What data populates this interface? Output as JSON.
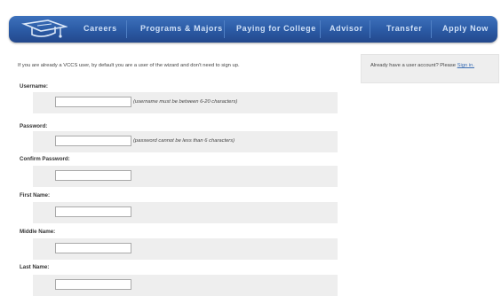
{
  "nav": {
    "items": [
      "Careers",
      "Programs & Majors",
      "Paying for College",
      "Advisor",
      "Transfer",
      "Apply Now"
    ]
  },
  "intro": "If you are already a VCCS user, by default you are a user of the wizard and don't need to sign up.",
  "sidebar": {
    "text": "Already have a user account? Please ",
    "link": "Sign in."
  },
  "form": {
    "fields": [
      {
        "label": "Username:",
        "value": "",
        "hint": "(username must be between 6-20 characters)"
      },
      {
        "label": "Password:",
        "value": "",
        "hint": "(password cannot be less than 6 characters)"
      },
      {
        "label": "Confirm Password:",
        "value": "",
        "hint": ""
      },
      {
        "label": "First Name:",
        "value": "",
        "hint": ""
      },
      {
        "label": "Middle Name:",
        "value": "",
        "hint": ""
      },
      {
        "label": "Last Name:",
        "value": "",
        "hint": ""
      }
    ]
  },
  "colors": {
    "nav_top": "#3d71bc",
    "nav_bottom": "#23488c",
    "nav_text": "#cfe0f7",
    "row_bg": "#eeeeee",
    "link": "#3c6fb4"
  }
}
